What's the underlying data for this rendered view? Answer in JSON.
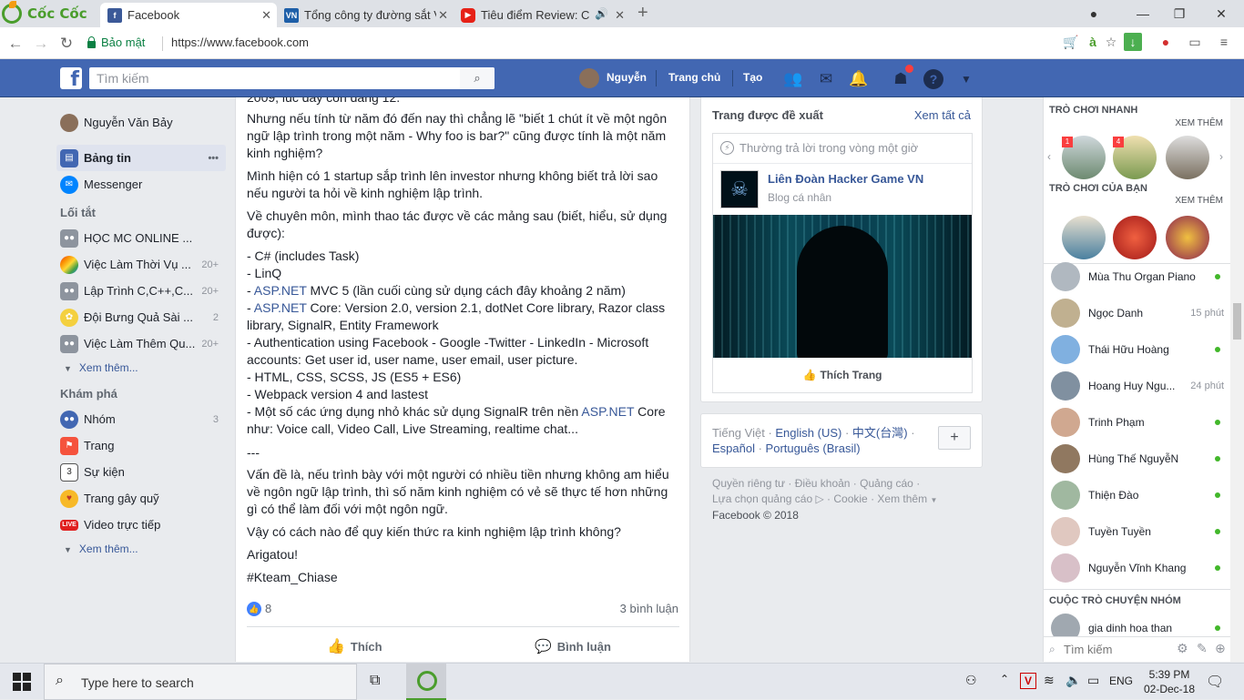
{
  "browser": {
    "brand": "Cốc Cốc",
    "tabs": [
      {
        "title": "Facebook",
        "favicon": "facebook-icon",
        "active": true
      },
      {
        "title": "Tổng công ty đường sắt Việt Nam",
        "favicon": "vnr-icon",
        "active": false
      },
      {
        "title": "Tiêu điểm Review: Con",
        "favicon": "youtube-icon",
        "active": false
      }
    ],
    "secure_label": "Bảo mật",
    "url": "https://www.facebook.com"
  },
  "fb_header": {
    "search_placeholder": "Tìm kiếm",
    "user_name": "Nguyễn",
    "home_label": "Trang chủ",
    "create_label": "Tạo"
  },
  "left_nav": {
    "profile": "Nguyễn Văn Bảy",
    "news_feed": "Bảng tin",
    "messenger": "Messenger",
    "shortcuts_title": "Lối tắt",
    "shortcuts": [
      {
        "label": "HỌC MC ONLINE ...",
        "count": ""
      },
      {
        "label": "Việc Làm Thời Vụ ...",
        "count": "20+"
      },
      {
        "label": "Lập Trình C,C++,C...",
        "count": "20+"
      },
      {
        "label": "Đội Bưng Quả Sài ...",
        "count": "2"
      },
      {
        "label": "Việc Làm Thêm Qu...",
        "count": "20+"
      }
    ],
    "see_more": "Xem thêm...",
    "explore_title": "Khám phá",
    "explore": [
      {
        "label": "Nhóm",
        "count": "3"
      },
      {
        "label": "Trang",
        "count": ""
      },
      {
        "label": "Sự kiện",
        "count": ""
      },
      {
        "label": "Trang gây quỹ",
        "count": ""
      },
      {
        "label": "Video trực tiếp",
        "count": ""
      }
    ],
    "see_more2": "Xem thêm..."
  },
  "post": {
    "cut_line": "2009, lúc đấy còn đang 12.",
    "para1": "Nhưng nếu tính từ năm đó đến nay thì chẳng lẽ \"biết 1 chút ít về một ngôn ngữ lập trình trong một năm - Why foo is bar?\" cũng được tính là một năm kinh nghiệm?",
    "para2": "Mình hiện có 1 startup sắp trình lên investor nhưng không biết trả lời sao nếu người ta hỏi về kinh nghiệm lập trình.",
    "para3": "Về chuyên môn, mình thao tác được về các mảng sau (biết, hiểu, sử dụng được):",
    "list1": "- C# (includes Task)",
    "list2": "- LinQ",
    "list3_pre": "- ",
    "list3_link": "ASP.NET",
    "list3_post": " MVC 5 (lần cuối cùng sử dụng cách đây khoảng 2 năm)",
    "list4_link": "ASP.NET",
    "list4_post": " Core: Version 2.0, version 2.1, dotNet Core library, Razor class library, SignalR, Entity Framework",
    "list5": "- Authentication using Facebook - Google -Twitter - LinkedIn - Microsoft accounts: Get user id, user name, user email, user picture.",
    "list6": "- HTML, CSS, SCSS, JS (ES5 + ES6)",
    "list7": "- Webpack version 4 and lastest",
    "list8_pre": "- Một số các ứng dụng nhỏ khác sử dụng SignalR trên nền ",
    "list8_link": "ASP.NET",
    "list8_post": " Core như: Voice call, Video Call, Live Streaming, realtime chat...",
    "separator": "---",
    "para4": "Vấn đề là, nếu trình bày với một người có nhiều tiền nhưng không am hiểu về ngôn ngữ lập trình, thì số năm kinh nghiệm có vẻ sẽ thực tế hơn những gì có thể làm đối với một ngôn ngữ.",
    "para5": "Vậy có cách nào để quy kiến thức ra kinh nghiệm lập trình không?",
    "para6": "Arigatou!",
    "hashtag": "#Kteam_Chiase",
    "like_count": "8",
    "comments": "3 bình luận",
    "like_btn": "Thích",
    "comment_btn": "Bình luận"
  },
  "suggested": {
    "title": "Trang được đề xuất",
    "see_all": "Xem tất cả",
    "reply_note": "Thường trả lời trong vòng một giờ",
    "page_name": "Liên Đoàn Hacker Game VN",
    "page_type": "Blog cá nhân",
    "like_page": "Thích Trang"
  },
  "languages": {
    "current": "Tiếng Việt",
    "options": [
      "English (US)",
      "中文(台灣)",
      "Español",
      "Português (Brasil)"
    ],
    "add": "+"
  },
  "footer": {
    "links1": [
      "Quyền riêng tư",
      "Điều khoản",
      "Quảng cáo"
    ],
    "links2": [
      "Lựa chọn quảng cáo",
      "Cookie",
      "Xem thêm"
    ],
    "copyright": "Facebook © 2018"
  },
  "chat": {
    "quick_games": "TRÒ CHƠI NHANH",
    "your_games": "TRÒ CHƠI CỦA BẠN",
    "see_more": "XEM THÊM",
    "badges": [
      "1",
      "4"
    ],
    "contacts": [
      {
        "name": "Mùa Thu Organ Piano",
        "status": "online"
      },
      {
        "name": "Ngọc Danh",
        "status": "15 phút"
      },
      {
        "name": "Thái Hữu Hoàng",
        "status": "online"
      },
      {
        "name": "Hoang Huy Ngu...",
        "status": "24 phút"
      },
      {
        "name": "Trinh Phạm",
        "status": "online"
      },
      {
        "name": "Hùng Thế NguyễN",
        "status": "online"
      },
      {
        "name": "Thiện Đào",
        "status": "online"
      },
      {
        "name": "Tuyền Tuyền",
        "status": "online"
      },
      {
        "name": "Nguyễn Vĩnh Khang",
        "status": "online"
      }
    ],
    "groups_title": "CUỘC TRÒ CHUYỆN NHÓM",
    "group1": "gia dinh hoa than",
    "search_placeholder": "Tìm kiếm"
  },
  "taskbar": {
    "search_placeholder": "Type here to search",
    "lang": "ENG",
    "time": "5:39 PM",
    "date": "02-Dec-18"
  },
  "colors": {
    "fb_blue": "#4267b2",
    "link": "#385898",
    "online": "#42b72a"
  }
}
